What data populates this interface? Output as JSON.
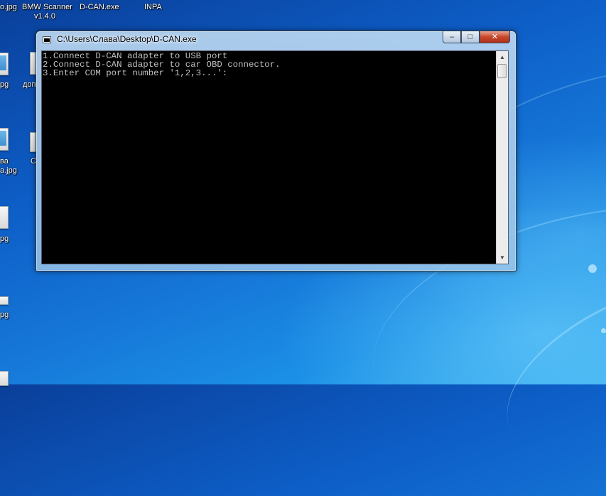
{
  "desktop": {
    "top_labels": [
      {
        "text": "o.jpg"
      },
      {
        "text": "BMW Scanner"
      },
      {
        "text": "v1.4.0"
      },
      {
        "text": "D-CAN.exe"
      },
      {
        "text": "INPA"
      }
    ],
    "left_labels": [
      {
        "text": "pg"
      },
      {
        "text": "доп"
      },
      {
        "text": "ва"
      },
      {
        "text": "а.jpg"
      },
      {
        "text": "С"
      },
      {
        "text": "pg"
      },
      {
        "text": "pg"
      }
    ]
  },
  "window": {
    "title": "C:\\Users\\Слава\\Desktop\\D-CAN.exe",
    "minimize_glyph": "‒",
    "maximize_glyph": "□",
    "close_glyph": "✕",
    "console_lines": [
      "1.Connect D-CAN adapter to USB port",
      "2.Connect D-CAN adapter to car OBD connector.",
      "3.Enter COM port number '1,2,3...':"
    ],
    "scroll_up_glyph": "▲",
    "scroll_down_glyph": "▼"
  }
}
